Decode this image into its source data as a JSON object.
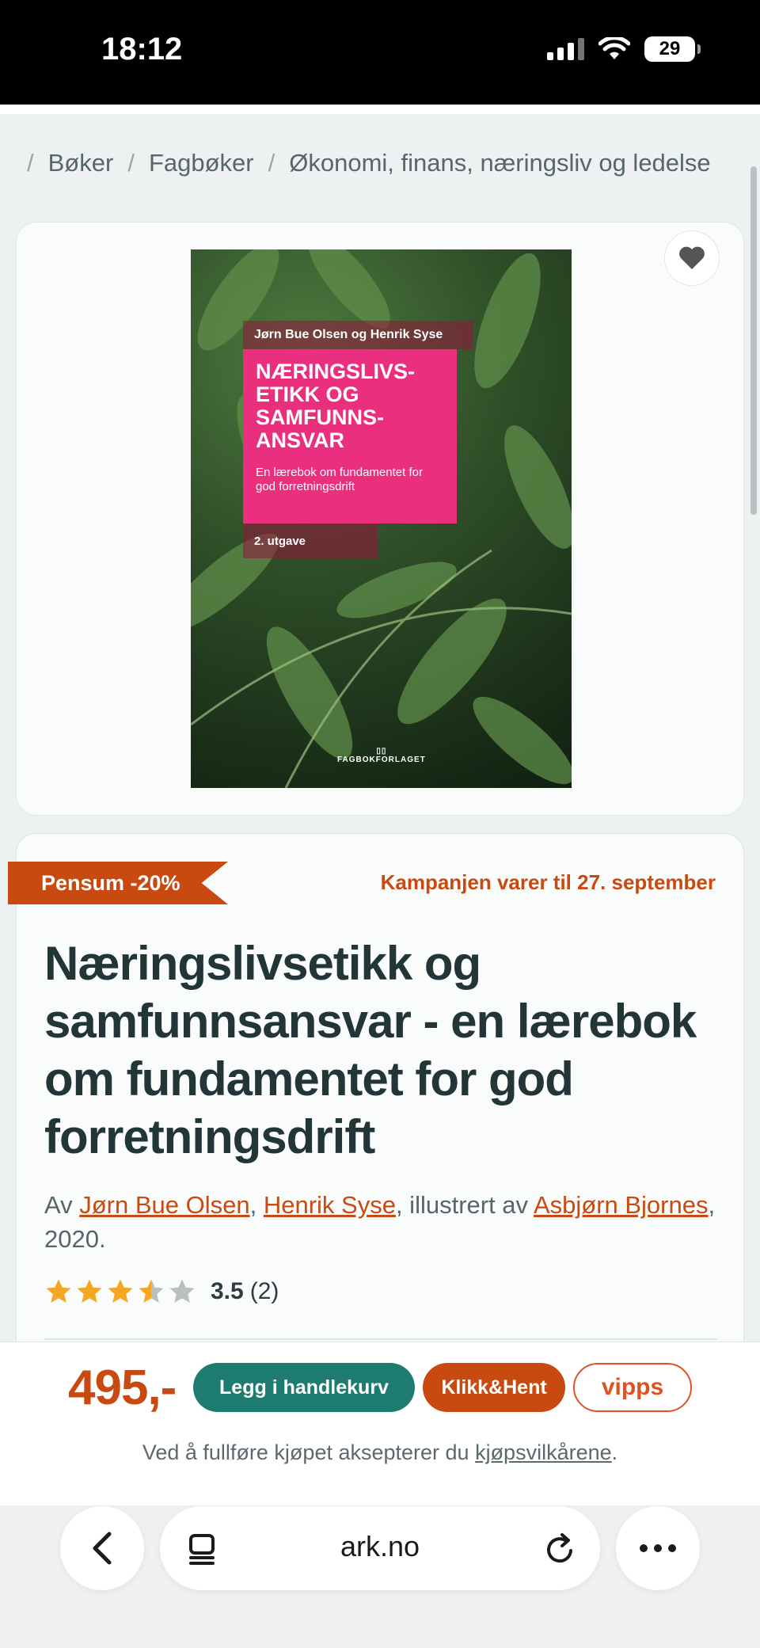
{
  "status_bar": {
    "time": "18:12",
    "battery": "29"
  },
  "breadcrumb": {
    "items": [
      "Bøker",
      "Fagbøker",
      "Økonomi, finans, næringsliv og ledelse"
    ]
  },
  "cover": {
    "authors": "Jørn Bue Olsen og Henrik Syse",
    "title_line1": "NÆRINGSLIVS-",
    "title_line2": "ETIKK OG",
    "title_line3": "SAMFUNNS-",
    "title_line4": "ANSVAR",
    "subtitle": "En lærebok om fundamentet for god forretningsdrift",
    "edition": "2. utgave",
    "publisher": "FAGBOKFORLAGET"
  },
  "campaign": {
    "tag": "Pensum -20%",
    "ends": "Kampanjen varer til 27. september"
  },
  "product": {
    "title": "Næringslivsetikk og samfunnsansvar - en lærebok om fundamentet for god forretningsdrift",
    "by_prefix": "Av ",
    "author1": "Jørn Bue Olsen",
    "sep1": ", ",
    "author2": "Henrik Syse",
    "illustrated_by": ", illustrert av ",
    "illustrator": "Asbjørn Bjornes",
    "year": ", 2020."
  },
  "rating": {
    "value": "3.5",
    "count": "(2)",
    "stars": 3.5
  },
  "buy": {
    "price": "495,-",
    "cart_label": "Legg i handlekurv",
    "klikk_label": "Klikk&Hent",
    "vipps_label": "vipps",
    "terms_prefix": "Ved å fullføre kjøpet aksepterer du ",
    "terms_link": "kjøpsvilkårene",
    "terms_suffix": "."
  },
  "browser": {
    "url": "ark.no"
  },
  "colors": {
    "accent": "#c94a10",
    "primary": "#1d7b70",
    "text": "#223537"
  }
}
